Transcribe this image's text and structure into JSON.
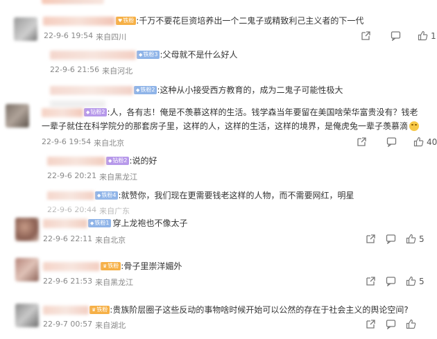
{
  "colors": {
    "badge_gold": "#f6b046",
    "badge_blue": "#8fb4e8",
    "badge_purple": "#b799ea",
    "meta": "#888888"
  },
  "comments": [
    {
      "badge": "铁粉",
      "text": ":千万不要花巨资培养出一个二鬼子或精致利己主义者的下一代",
      "time": "22-9-6 19:54",
      "location": "来自四川",
      "likes": "119"
    },
    {
      "badge": "铁粉3",
      "text": ":父母就不是什么好人",
      "time": "22-9-6 21:56",
      "location": "来自河北"
    },
    {
      "badge": "铁粉2",
      "text": ":这种从小接受西方教育的，成为二鬼子可能性极大"
    },
    {
      "badge": "钻粉2",
      "text_line1": ":人，各有志！俺是不羡慕这样的生活。钱学森当年要留在美国啥荣华富贵没有？钱老",
      "text_line2": "一辈子就住在科学院分的那套房子里，这样的人，这样的生活，这样的境界，是俺虎兔一辈子羡慕滴",
      "emoji": "crying-laughing-emoji",
      "time": "22-9-6 19:54",
      "location": "来自北京",
      "likes": "404"
    },
    {
      "badge": "钻粉2",
      "text": ":说的好",
      "time": "22-9-6 20:21",
      "location": "来自黑龙江"
    },
    {
      "badge": "铁粉4",
      "text": ":就赞你，我们现在更需要钱老这样的人物，而不需要网红，明星",
      "time": "22-9-6 20:44",
      "location": "来自广东"
    },
    {
      "badge": "铁粉1",
      "text": "穿上龙袍也不像太子",
      "time": "22-9-6 22:11",
      "location": "来自北京",
      "likes": "5"
    },
    {
      "badge": "铁粉",
      "text": ":骨子里崇洋媚外",
      "time": "22-9-6 21:53",
      "location": "来自黑龙江",
      "likes": "5"
    },
    {
      "badge": "铁粉",
      "text": ":贵族阶层圈子这些反动的事物啥时候开始可以公然的存在于社会主义的舆论空间?",
      "time": "22-9-7 00:57",
      "location": "来自湖北"
    }
  ],
  "icons": {
    "share": "share-icon",
    "comment": "comment-icon",
    "like": "like-icon"
  }
}
